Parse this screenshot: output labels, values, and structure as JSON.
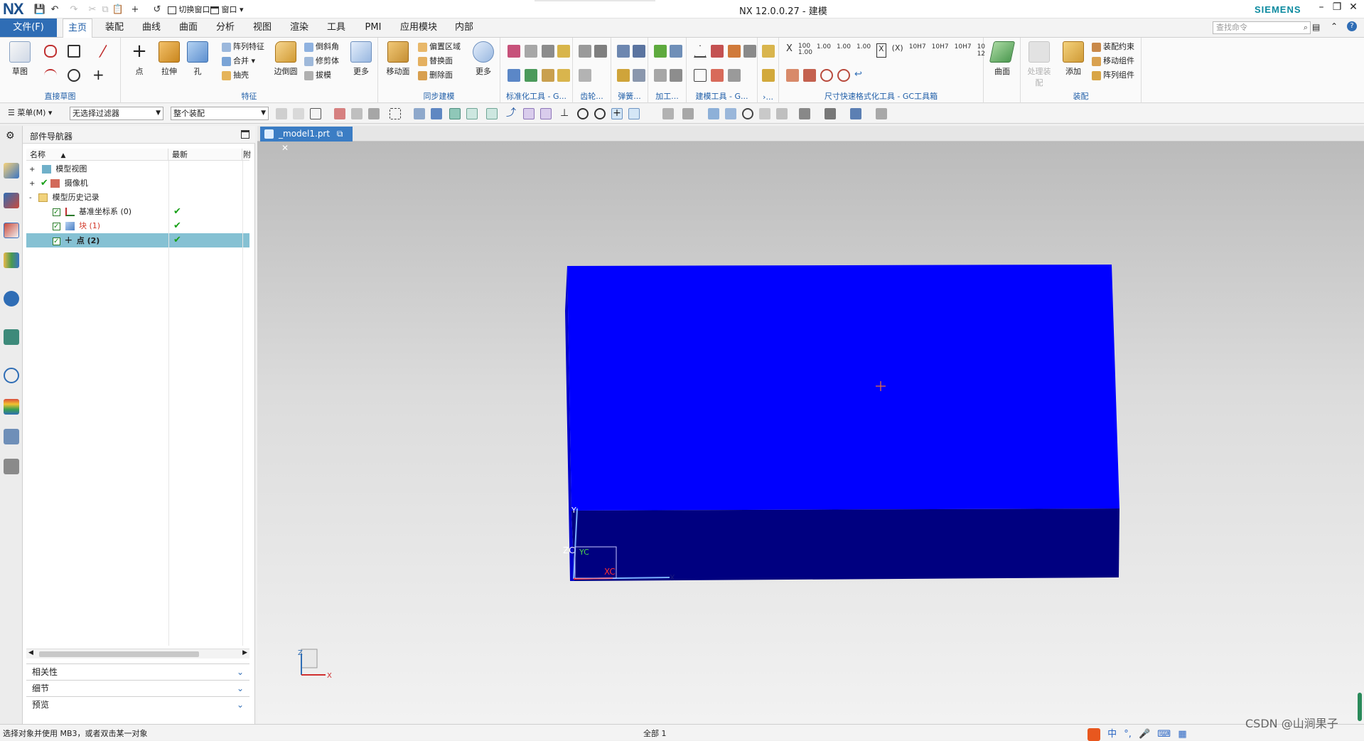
{
  "app": {
    "logo": "NX",
    "title": "NX 12.0.0.27 - 建模",
    "brand": "SIEMENS",
    "quick_access": {
      "switch_window": "切换窗口",
      "window": "窗口"
    }
  },
  "ribbon_tabs": {
    "file": "文件(F)",
    "tabs": [
      "主页",
      "装配",
      "曲线",
      "曲面",
      "分析",
      "视图",
      "渲染",
      "工具",
      "PMI",
      "应用模块",
      "内部"
    ],
    "active": "主页",
    "find_placeholder": "查找命令"
  },
  "ribbon": {
    "groups": {
      "direct_sketch": "直接草图",
      "feature": "特征",
      "sync_modeling": "同步建模",
      "std_tools": "标准化工具 - G...",
      "gear": "齿轮...",
      "spring": "弹簧...",
      "machining": "加工...",
      "modeling_tools": "建模工具 - G...",
      "more_small": "›...",
      "dim_tools": "尺寸快速格式化工具 - GC工具箱",
      "assembly": "装配"
    },
    "buttons": {
      "sketch": "草图",
      "point": "点",
      "extrude": "拉伸",
      "hole": "孔",
      "pattern_feature": "阵列特征",
      "unite": "合并",
      "shell": "抽壳",
      "edge_blend": "边倒圆",
      "chamfer": "倒斜角",
      "trim_body": "修剪体",
      "draft": "拔模",
      "more1": "更多",
      "move_face": "移动面",
      "offset_region": "偏置区域",
      "replace_face": "替换面",
      "delete_face": "删除面",
      "more2": "更多",
      "surface": "曲面",
      "process_assembly": "处理装配",
      "add": "添加",
      "assembly_constraints": "装配约束",
      "move_component": "移动组件",
      "pattern_component": "阵列组件"
    },
    "dim_labels": [
      "X",
      "100 1.00",
      "1.00",
      "1.00",
      "1.00",
      "X",
      "(X)",
      "10H7",
      "10H7",
      "10H7",
      "10 12"
    ]
  },
  "toolbar": {
    "menu": "菜单(M)",
    "filter": "无选择过滤器",
    "scope": "整个装配"
  },
  "navigator": {
    "title": "部件导航器",
    "col_name": "名称",
    "col_latest": "最新",
    "col_extra": "附",
    "rows": [
      {
        "label": "模型视图",
        "latest": "",
        "indent": 0,
        "expander": "+",
        "checked": false
      },
      {
        "label": "摄像机",
        "latest": "",
        "indent": 0,
        "expander": "+",
        "checked": true
      },
      {
        "label": "模型历史记录",
        "latest": "",
        "indent": 0,
        "expander": "-",
        "checked": false
      },
      {
        "label": "基准坐标系 (0)",
        "latest": "✔",
        "indent": 1,
        "expander": "",
        "checked": true
      },
      {
        "label": "块 (1)",
        "latest": "✔",
        "indent": 1,
        "expander": "",
        "checked": true
      },
      {
        "label": "点 (2)",
        "latest": "✔",
        "indent": 1,
        "expander": "",
        "checked": true
      }
    ],
    "panels": [
      "相关性",
      "细节",
      "预览"
    ]
  },
  "graphics": {
    "tab": "_model1.prt",
    "axis_labels": {
      "zc": "ZC",
      "yc": "YC",
      "xc": "XC",
      "z": "Z",
      "x": "X",
      "y": "Y"
    }
  },
  "status": {
    "prompt": "选择对象并使用 MB3，或者双击某一对象",
    "selection": "全部 1"
  },
  "watermark": "CSDN @山涧果子",
  "colors": {
    "accent": "#2f6db5",
    "block_top": "#0000ff",
    "block_front": "#000080",
    "selection": "#85c1d3"
  }
}
